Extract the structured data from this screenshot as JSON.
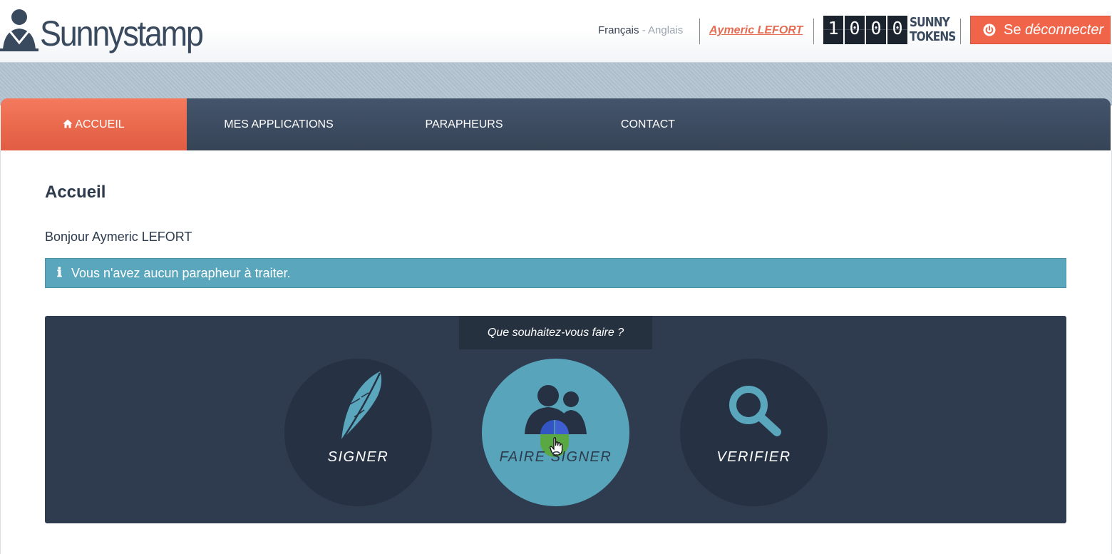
{
  "header": {
    "logo_text": "Sunnystamp",
    "lang_fr": "Français",
    "lang_sep": "-",
    "lang_en": "Anglais",
    "user_name": "Aymeric LEFORT",
    "tokens": {
      "digits": [
        "1",
        "0",
        "0",
        "0"
      ],
      "label_top": "SUNNY",
      "label_bottom": "TOKENS"
    },
    "logout_prefix": "Se",
    "logout_main": "déconnecter"
  },
  "nav": {
    "items": [
      {
        "label": "ACCUEIL",
        "active": true,
        "icon": "home-icon"
      },
      {
        "label": "MES APPLICATIONS",
        "active": false
      },
      {
        "label": "PARAPHEURS",
        "active": false
      },
      {
        "label": "CONTACT",
        "active": false
      }
    ]
  },
  "main": {
    "title": "Accueil",
    "greeting": "Bonjour Aymeric LEFORT",
    "alert": {
      "icon": "info-icon",
      "text": "Vous n'avez aucun parapheur à traiter."
    },
    "actions": {
      "title": "Que souhaitez-vous faire ?",
      "items": [
        {
          "label": "SIGNER",
          "icon": "feather-icon"
        },
        {
          "label": "FAIRE SIGNER",
          "icon": "users-icon",
          "state": "hover"
        },
        {
          "label": "VERIFIER",
          "icon": "magnifier-icon"
        }
      ]
    }
  },
  "colors": {
    "accent": "#f0654a",
    "nav_bg": "#3d4c61",
    "alert_bg": "#5aa6bd",
    "panel_bg": "#2f3c4f",
    "circle_bg": "#263244",
    "circle_hover": "#58a4bb"
  }
}
